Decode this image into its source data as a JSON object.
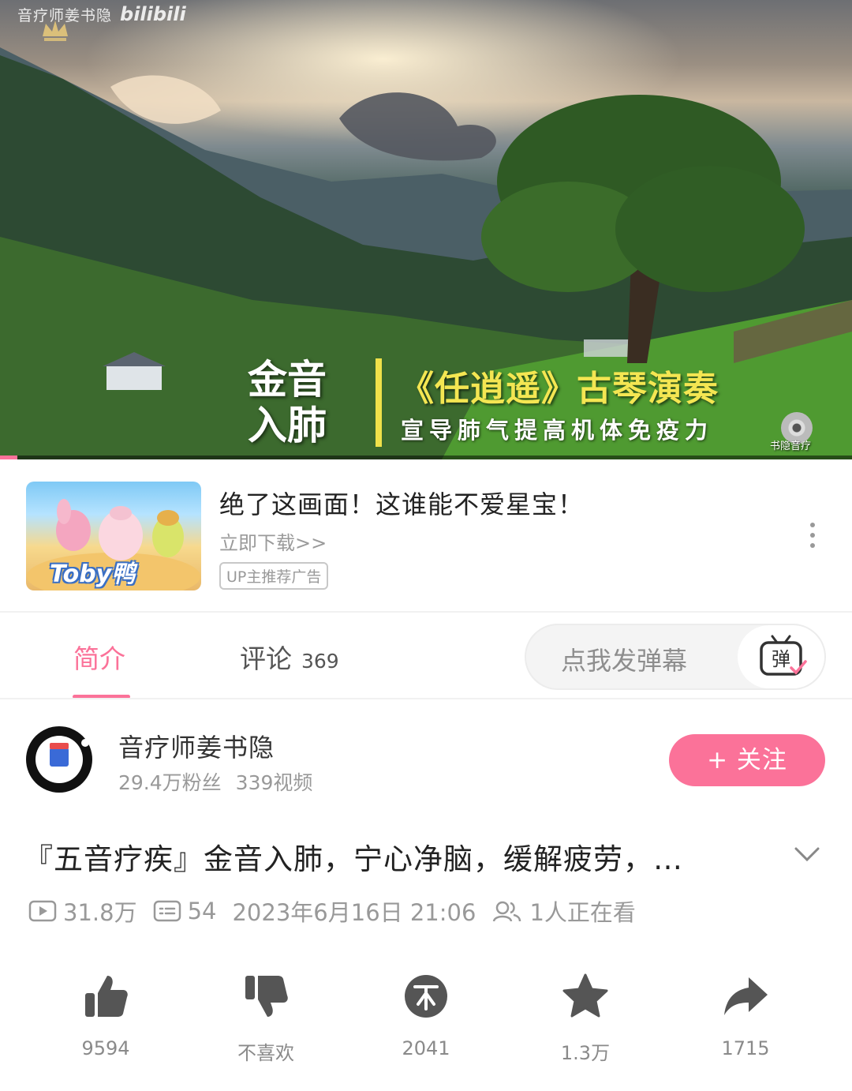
{
  "video": {
    "watermark_channel": "音疗师姜书隐",
    "watermark_brand": "bilibili",
    "overlay_left_line1": "金音",
    "overlay_left_line2": "入肺",
    "overlay_title": "《任逍遥》古琴演奏",
    "overlay_subtitle": "宣导肺气提高机体免疫力",
    "overlay_corner_label": "书隐音疗",
    "progress_fraction": 0.02,
    "accent_color": "#fb7299"
  },
  "ad": {
    "thumb_label": "Toby鸭",
    "title": "绝了这画面！这谁能不爱星宝！",
    "link": "立即下载>>",
    "badge": "UP主推荐广告"
  },
  "tabs": {
    "intro": "简介",
    "comments": "评论",
    "comments_count": "369",
    "danmaku_placeholder": "点我发弹幕",
    "danmaku_icon_char": "弹"
  },
  "uploader": {
    "name": "音疗师姜书隐",
    "followers": "29.4万粉丝",
    "videos": "339视频",
    "follow_label": "+ 关注"
  },
  "video_info": {
    "title": "『五音疗疾』金音入肺，宁心净脑，缓解疲劳，…",
    "views": "31.8万",
    "danmaku_count": "54",
    "date": "2023年6月16日 21:06",
    "watching": "1人正在看"
  },
  "actions": {
    "like": "9594",
    "dislike": "不喜欢",
    "coin": "2041",
    "favorite": "1.3万",
    "share": "1715"
  }
}
